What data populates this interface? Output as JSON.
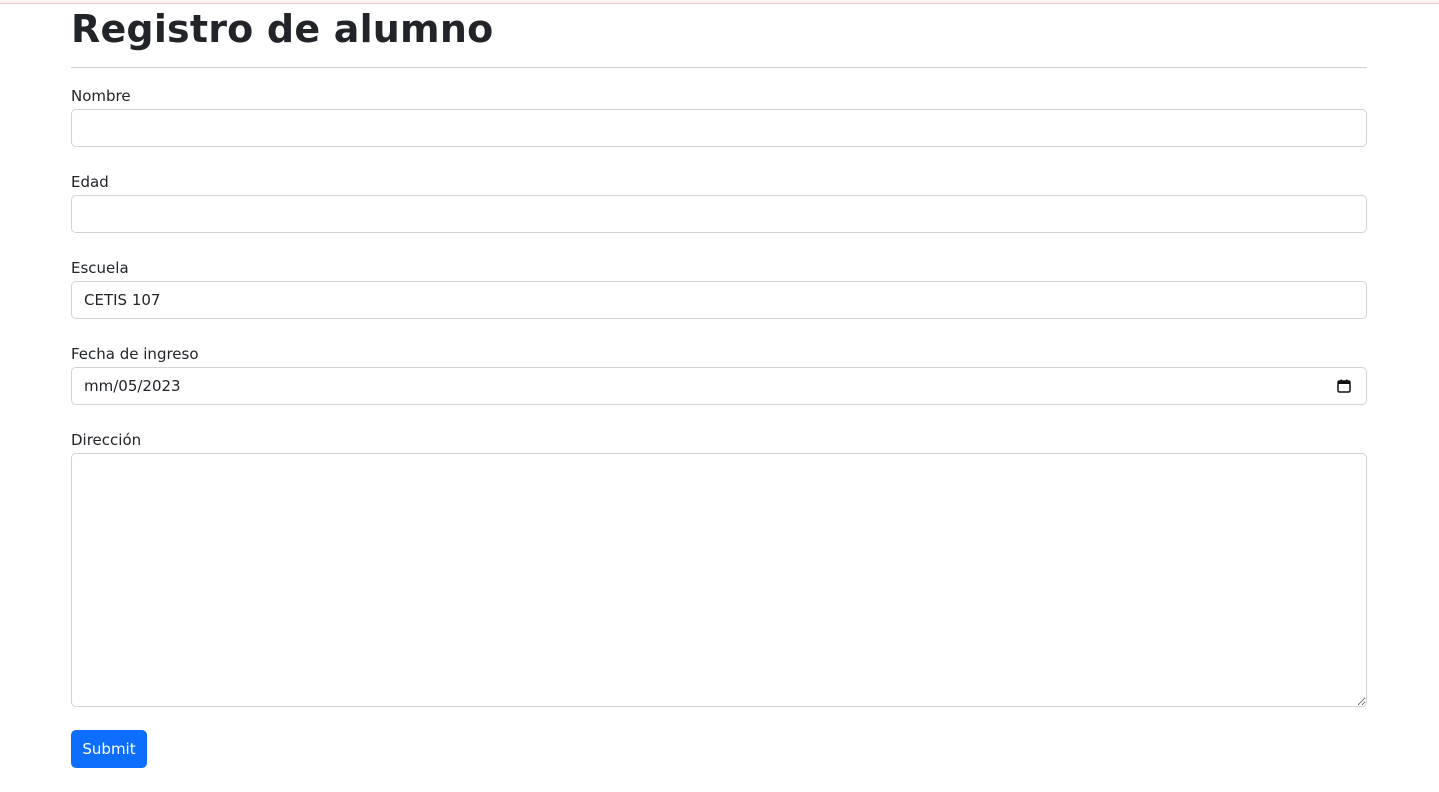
{
  "page": {
    "title": "Registro de alumno"
  },
  "form": {
    "fields": [
      {
        "label": "Nombre",
        "value": "",
        "type": "text"
      },
      {
        "label": "Edad",
        "value": "",
        "type": "text"
      },
      {
        "label": "Escuela",
        "value": "CETIS 107",
        "type": "text"
      },
      {
        "label": "Fecha de ingreso",
        "value": "mm/05/2023",
        "type": "date",
        "icon": "calendar-icon"
      },
      {
        "label": "Dirección",
        "value": "",
        "type": "textarea"
      }
    ],
    "submit_label": "Submit"
  },
  "colors": {
    "primary": "#0d6efd",
    "border": "#ced4da",
    "text": "#212529"
  }
}
